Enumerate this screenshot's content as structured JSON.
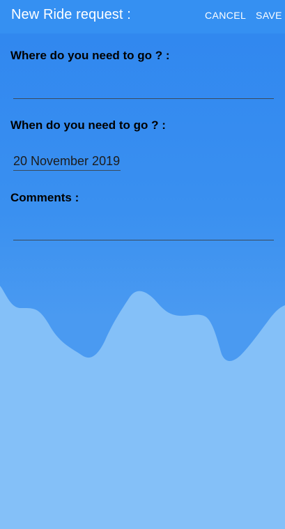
{
  "appbar": {
    "title": "New Ride request :",
    "cancel_label": "CANCEL",
    "save_label": "SAVE"
  },
  "form": {
    "destination": {
      "label": "Where do you need to go ? :",
      "value": ""
    },
    "date": {
      "label": "When do you need to go ? :",
      "value": "20 November 2019"
    },
    "comments": {
      "label": "Comments :",
      "value": ""
    }
  },
  "colors": {
    "background_top": "#2f86ef",
    "appbar": "#3590f2",
    "wave_fill": "#84c0f8",
    "label_text": "#000000",
    "appbar_text": "#ffffff"
  }
}
